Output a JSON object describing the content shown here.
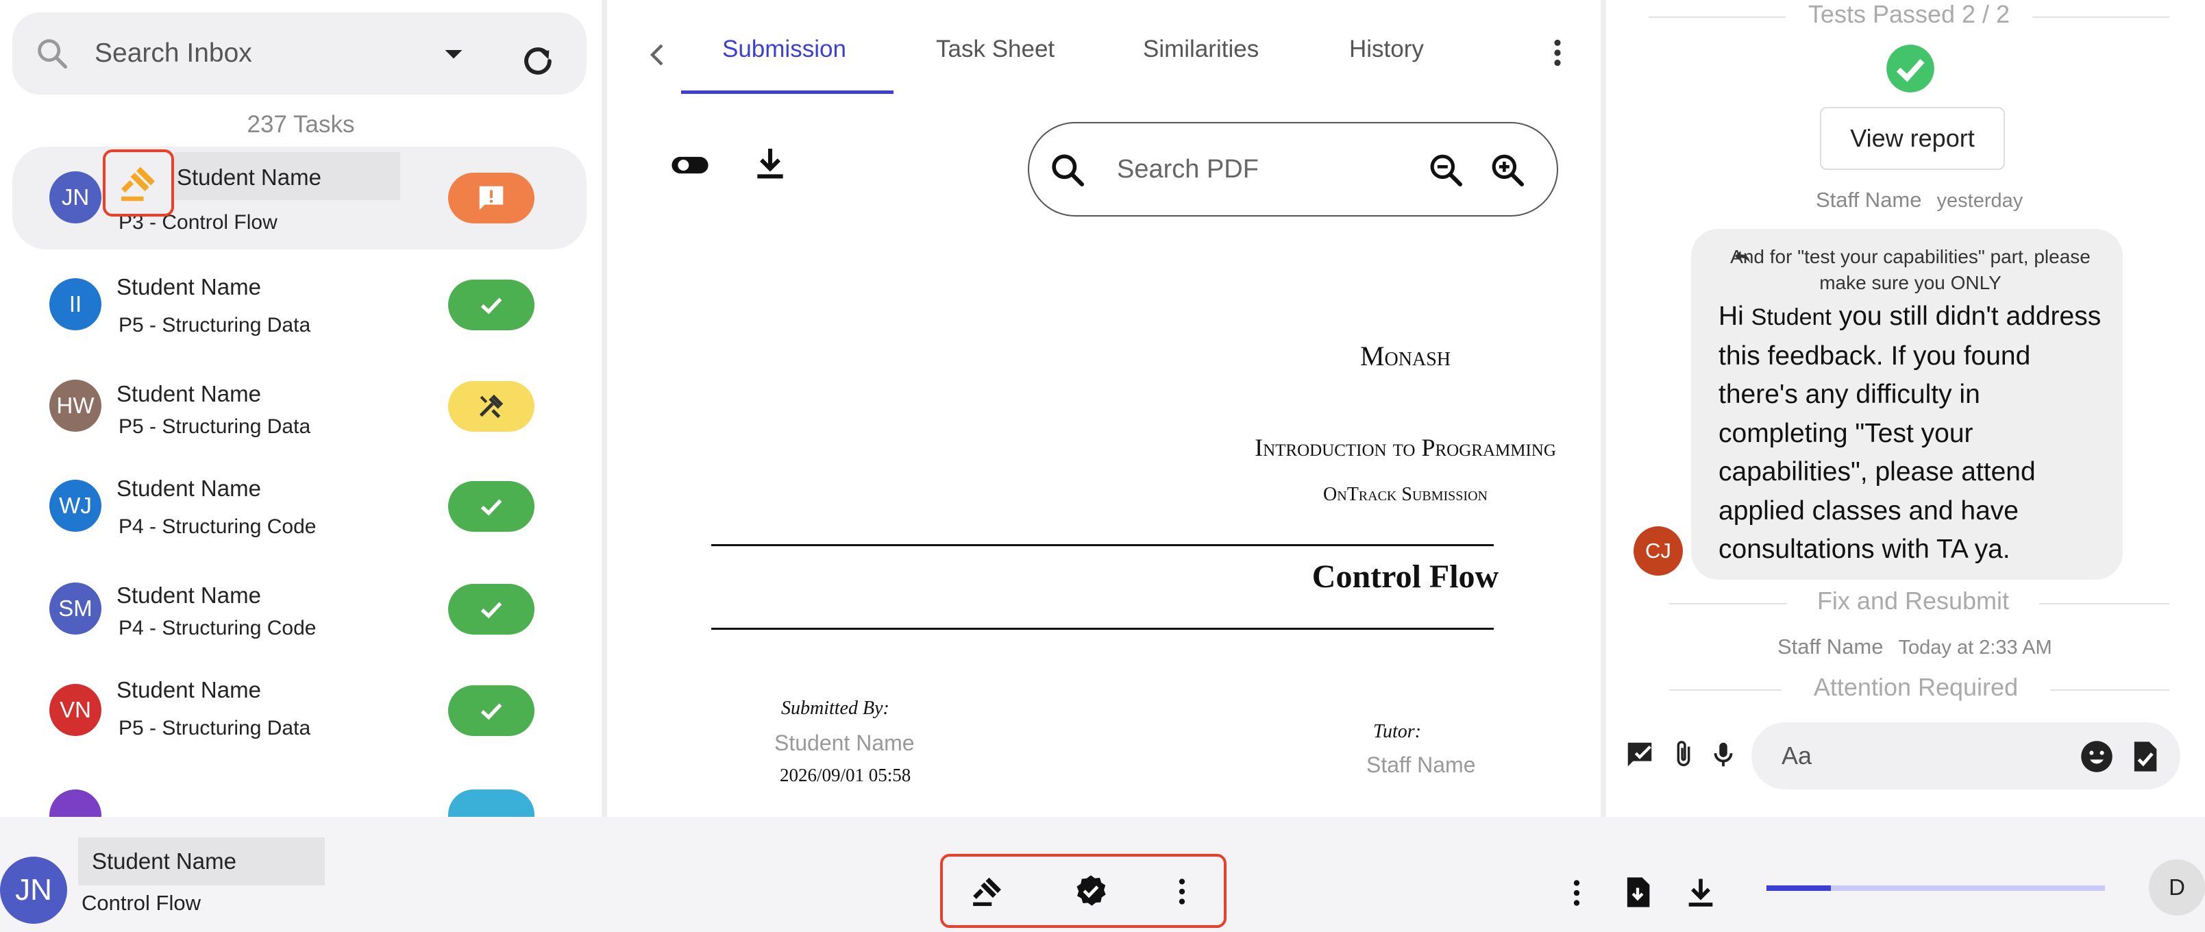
{
  "inbox": {
    "search_placeholder": "Search Inbox",
    "task_count": "237 Tasks",
    "tasks": [
      {
        "initials": "JN",
        "avatar_color": "#5060c0",
        "name": "Student Name",
        "unit": "P3 - Control Flow",
        "status": "discuss",
        "status_color": "#f08048",
        "selected": true
      },
      {
        "initials": "II",
        "avatar_color": "#1f77d0",
        "name": "Student Name",
        "unit": "P5 - Structuring Data",
        "status": "complete",
        "status_color": "#4caf50",
        "selected": false
      },
      {
        "initials": "HW",
        "avatar_color": "#8d6e63",
        "name": "Student Name",
        "unit": "P5 - Structuring Data",
        "status": "working on it",
        "status_color": "#f7dc60",
        "selected": false
      },
      {
        "initials": "WJ",
        "avatar_color": "#1f77d0",
        "name": "Student Name",
        "unit": "P4 - Structuring Code",
        "status": "complete",
        "status_color": "#4caf50",
        "selected": false
      },
      {
        "initials": "SM",
        "avatar_color": "#5060c0",
        "name": "Student Name",
        "unit": "P4 - Structuring Code",
        "status": "complete",
        "status_color": "#4caf50",
        "selected": false
      },
      {
        "initials": "VN",
        "avatar_color": "#d32f2f",
        "name": "Student Name",
        "unit": "P5 - Structuring Data",
        "status": "complete",
        "status_color": "#4caf50",
        "selected": false
      }
    ]
  },
  "viewer": {
    "tabs": [
      {
        "label": "Submission",
        "active": true
      },
      {
        "label": "Task Sheet",
        "active": false
      },
      {
        "label": "Similarities",
        "active": false
      },
      {
        "label": "History",
        "active": false
      }
    ],
    "pdf_search_placeholder": "Search PDF",
    "document": {
      "institution": "Monash",
      "course": "Introduction to Programming",
      "subtitle": "OnTrack Submission",
      "title": "Control Flow",
      "submitted_by_label": "Submitted By:",
      "student": "Student Name",
      "date": "2026/09/01 05:58",
      "tutor_label": "Tutor:",
      "tutor": "Staff Name"
    }
  },
  "chat": {
    "tests_passed": "Tests Passed 2 / 2",
    "view_report": "View report",
    "staff_1": "Staff Name",
    "time_1": "yesterday",
    "reply_quote": "And for \"test your capabilities\" part, please make sure you ONLY",
    "message_prefix": "Hi ",
    "message_name": "Student",
    "message_body": " you still didn't address this feedback. If you found there's any difficulty in completing \"Test your capabilities\", please attend applied classes and have consultations with TA ya.",
    "sender_initials": "CJ",
    "status_1": "Fix and Resubmit",
    "staff_2": "Staff Name",
    "time_2": "Today at 2:33 AM",
    "status_2": "Attention Required",
    "composer_placeholder": "Aa"
  },
  "bottom_bar": {
    "initials": "JN",
    "student_name": "Student Name",
    "unit": "Control Flow",
    "progress": 0.19,
    "user_initial": "D"
  },
  "colors": {
    "accent": "#3b3fd8",
    "highlight": "#e8402a",
    "discuss": "#f08048",
    "complete": "#4caf50",
    "working": "#f7dc60"
  }
}
